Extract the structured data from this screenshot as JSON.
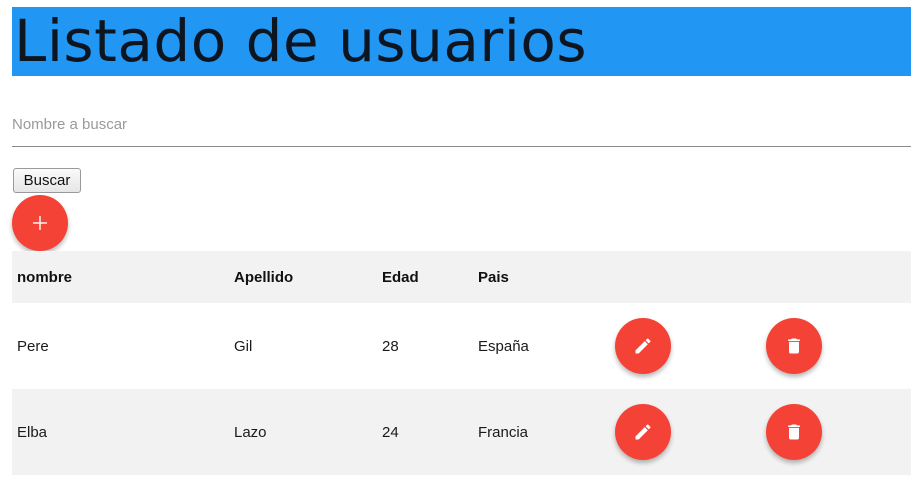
{
  "header": {
    "title": "Listado de usuarios"
  },
  "search": {
    "placeholder": "Nombre a buscar",
    "value": "",
    "button_label": "Buscar"
  },
  "add_button": {
    "icon": "plus-icon",
    "label": "+"
  },
  "table": {
    "columns": [
      "nombre",
      "Apellido",
      "Edad",
      "Pais",
      "",
      ""
    ],
    "rows": [
      {
        "nombre": "Pere",
        "apellido": "Gil",
        "edad": "28",
        "pais": "España"
      },
      {
        "nombre": "Elba",
        "apellido": "Lazo",
        "edad": "24",
        "pais": "Francia"
      }
    ],
    "row_actions": [
      {
        "icon": "pencil-icon",
        "action": "edit"
      },
      {
        "icon": "trash-icon",
        "action": "delete"
      }
    ]
  },
  "colors": {
    "title_bar": "#2196f3",
    "accent": "#f44336",
    "row_stripe": "#f2f2f2"
  }
}
